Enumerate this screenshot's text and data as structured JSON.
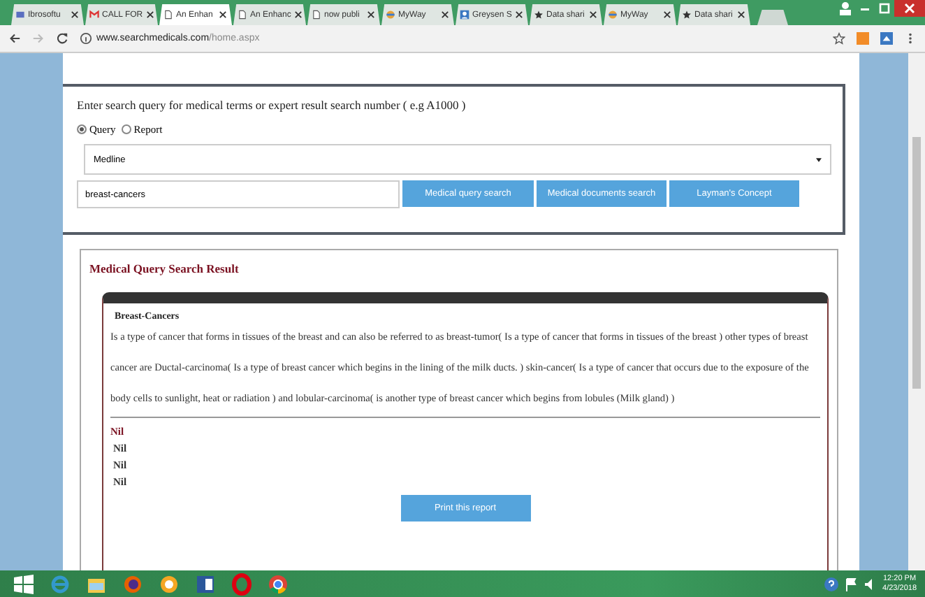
{
  "browser": {
    "tabs": [
      {
        "title": "Ibrosoftu",
        "selected": false
      },
      {
        "title": "CALL FOR",
        "selected": false
      },
      {
        "title": "An Enhan",
        "selected": true
      },
      {
        "title": "An Enhanc",
        "selected": false
      },
      {
        "title": "now publi",
        "selected": false
      },
      {
        "title": "MyWay",
        "selected": false
      },
      {
        "title": "Greysen S",
        "selected": false
      },
      {
        "title": "Data shari",
        "selected": false
      },
      {
        "title": "MyWay",
        "selected": false
      },
      {
        "title": "Data shari",
        "selected": false
      }
    ],
    "url_host": "www.searchmedicals.com",
    "url_path": "/home.aspx"
  },
  "search": {
    "prompt": "Enter search query for medical terms or expert result search number ( e.g A1000 )",
    "modes": [
      {
        "label": "Query",
        "selected": true
      },
      {
        "label": "Report",
        "selected": false
      }
    ],
    "database": "Medline",
    "query": "breast-cancers",
    "buttons": [
      "Medical query search",
      "Medical documents search",
      "Layman's Concept"
    ]
  },
  "result": {
    "title": "Medical Query Search Result",
    "term": "Breast-Cancers",
    "description": "Is a type of cancer that forms in tissues of the breast and can also be referred to as breast-tumor( Is a type of cancer that forms in tissues of the breast ) other types of breast cancer are Ductal-carcinoma( Is a type of breast cancer which begins in the lining of the milk ducts. ) skin-cancer( Is a type of cancer that occurs due to the exposure of the body cells to sunlight, heat or radiation ) and lobular-carcinoma( is another type of breast cancer which begins from lobules (Milk gland) )",
    "entries": [
      {
        "text": "Nil",
        "kind": "heading"
      },
      {
        "text": "Nil",
        "kind": "item"
      },
      {
        "text": "Nil",
        "kind": "item"
      },
      {
        "text": "Nil",
        "kind": "item"
      }
    ],
    "print_button": "Print this report"
  },
  "taskbar": {
    "time": "12:20 PM",
    "date": "4/23/2018"
  }
}
